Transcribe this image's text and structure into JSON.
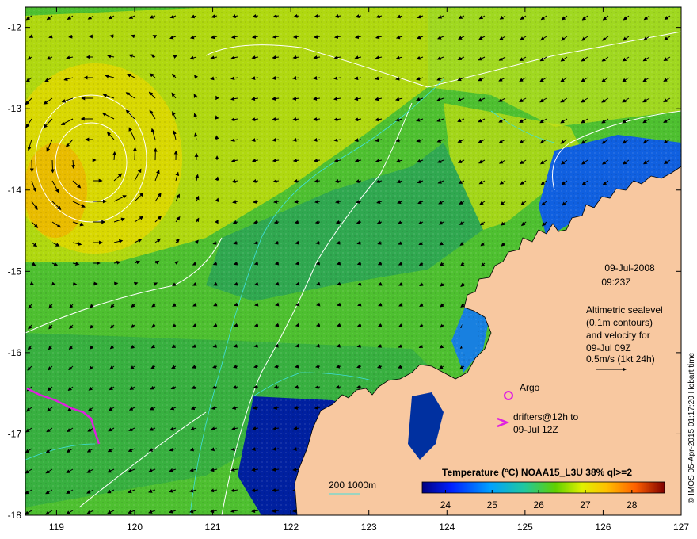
{
  "map": {
    "lon_ticks": [
      "119",
      "120",
      "121",
      "122",
      "123",
      "124",
      "125",
      "126",
      "127"
    ],
    "lat_ticks": [
      "-12",
      "-13",
      "-14",
      "-15",
      "-16",
      "-17",
      "-18"
    ],
    "lon_range": [
      118.6,
      127.0
    ],
    "lat_range": [
      -18.0,
      -11.75
    ]
  },
  "annotations": {
    "date": "09-Jul-2008",
    "time": "09:23Z",
    "altimetry_lines": [
      "Altimetric sealevel",
      "(0.1m contours)",
      "and velocity for",
      "09-Jul 09Z",
      "0.5m/s (1kt 24h)"
    ],
    "argo_label": "Argo",
    "drifters_line1": "drifters@12h to",
    "drifters_line2": "09-Jul 12Z",
    "depth_label": "200  1000m"
  },
  "colorbar": {
    "title": "Temperature (°C) NOAA15_L3U 38% ql>=2",
    "ticks": [
      "24",
      "25",
      "26",
      "27",
      "28"
    ],
    "range": [
      23.5,
      28.7
    ]
  },
  "credit": "© IMOS 05-Apr-2015 01:17:20 Hobart time",
  "colors": {
    "land": "#f8c8a0",
    "argo": "#e020e0",
    "drifter": "#e020e0",
    "contour": "#ffffff",
    "isobath": "#40e0e0"
  }
}
